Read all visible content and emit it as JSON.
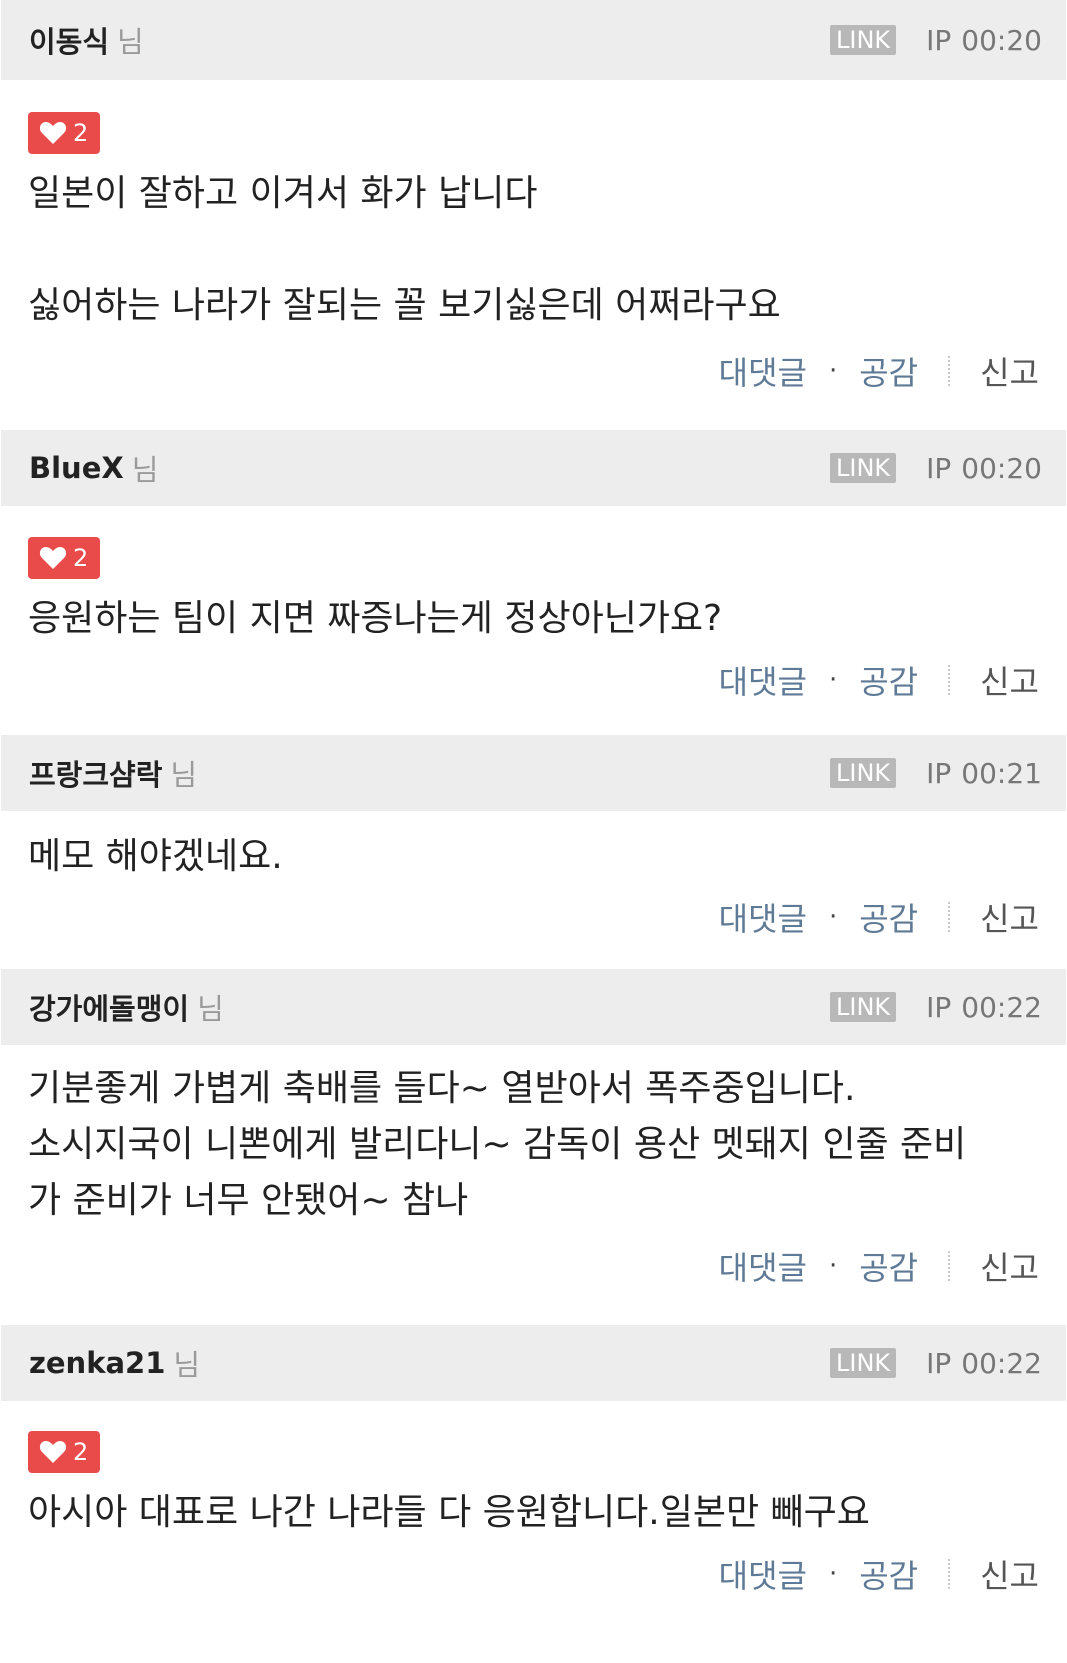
{
  "comments": [
    {
      "author": "이동식",
      "suffix": "님",
      "link": "LINK",
      "ip": "IP",
      "time": "00:20",
      "likes": "2",
      "text": "일본이 잘하고 이겨서 화가 납니다\n\n싫어하는 나라가 잘되는 꼴 보기싫은데 어쩌라구요",
      "reply": "대댓글",
      "dot": "·",
      "empathy": "공감",
      "report": "신고"
    },
    {
      "author": "BlueX",
      "suffix": "님",
      "link": "LINK",
      "ip": "IP",
      "time": "00:20",
      "likes": "2",
      "text": "응원하는 팀이 지면 짜증나는게 정상아닌가요?",
      "reply": "대댓글",
      "dot": "·",
      "empathy": "공감",
      "report": "신고"
    },
    {
      "author": "프랑크샴락",
      "suffix": "님",
      "link": "LINK",
      "ip": "IP",
      "time": "00:21",
      "text": "메모 해야겠네요.",
      "reply": "대댓글",
      "dot": "·",
      "empathy": "공감",
      "report": "신고"
    },
    {
      "author": "강가에돌맹이",
      "suffix": "님",
      "link": "LINK",
      "ip": "IP",
      "time": "00:22",
      "text": "기분좋게 가볍게 축배를 들다~ 열받아서 폭주중입니다.\n소시지국이 니뽄에게 발리다니~ 감독이 용산 멧돼지 인줄 준비\n가 준비가 너무 안됐어~ 참나",
      "reply": "대댓글",
      "dot": "·",
      "empathy": "공감",
      "report": "신고"
    },
    {
      "author": "zenka21",
      "suffix": "님",
      "link": "LINK",
      "ip": "IP",
      "time": "00:22",
      "likes": "2",
      "text": "아시아 대표로 나간 나라들 다 응원합니다.일본만 빼구요",
      "reply": "대댓글",
      "dot": "·",
      "empathy": "공감",
      "report": "신고"
    }
  ],
  "colors": {
    "header_bg": "#ededed",
    "like_badge": "#e94b4b",
    "action_link": "#5f7a96",
    "link_badge": "#b8b8b8"
  }
}
